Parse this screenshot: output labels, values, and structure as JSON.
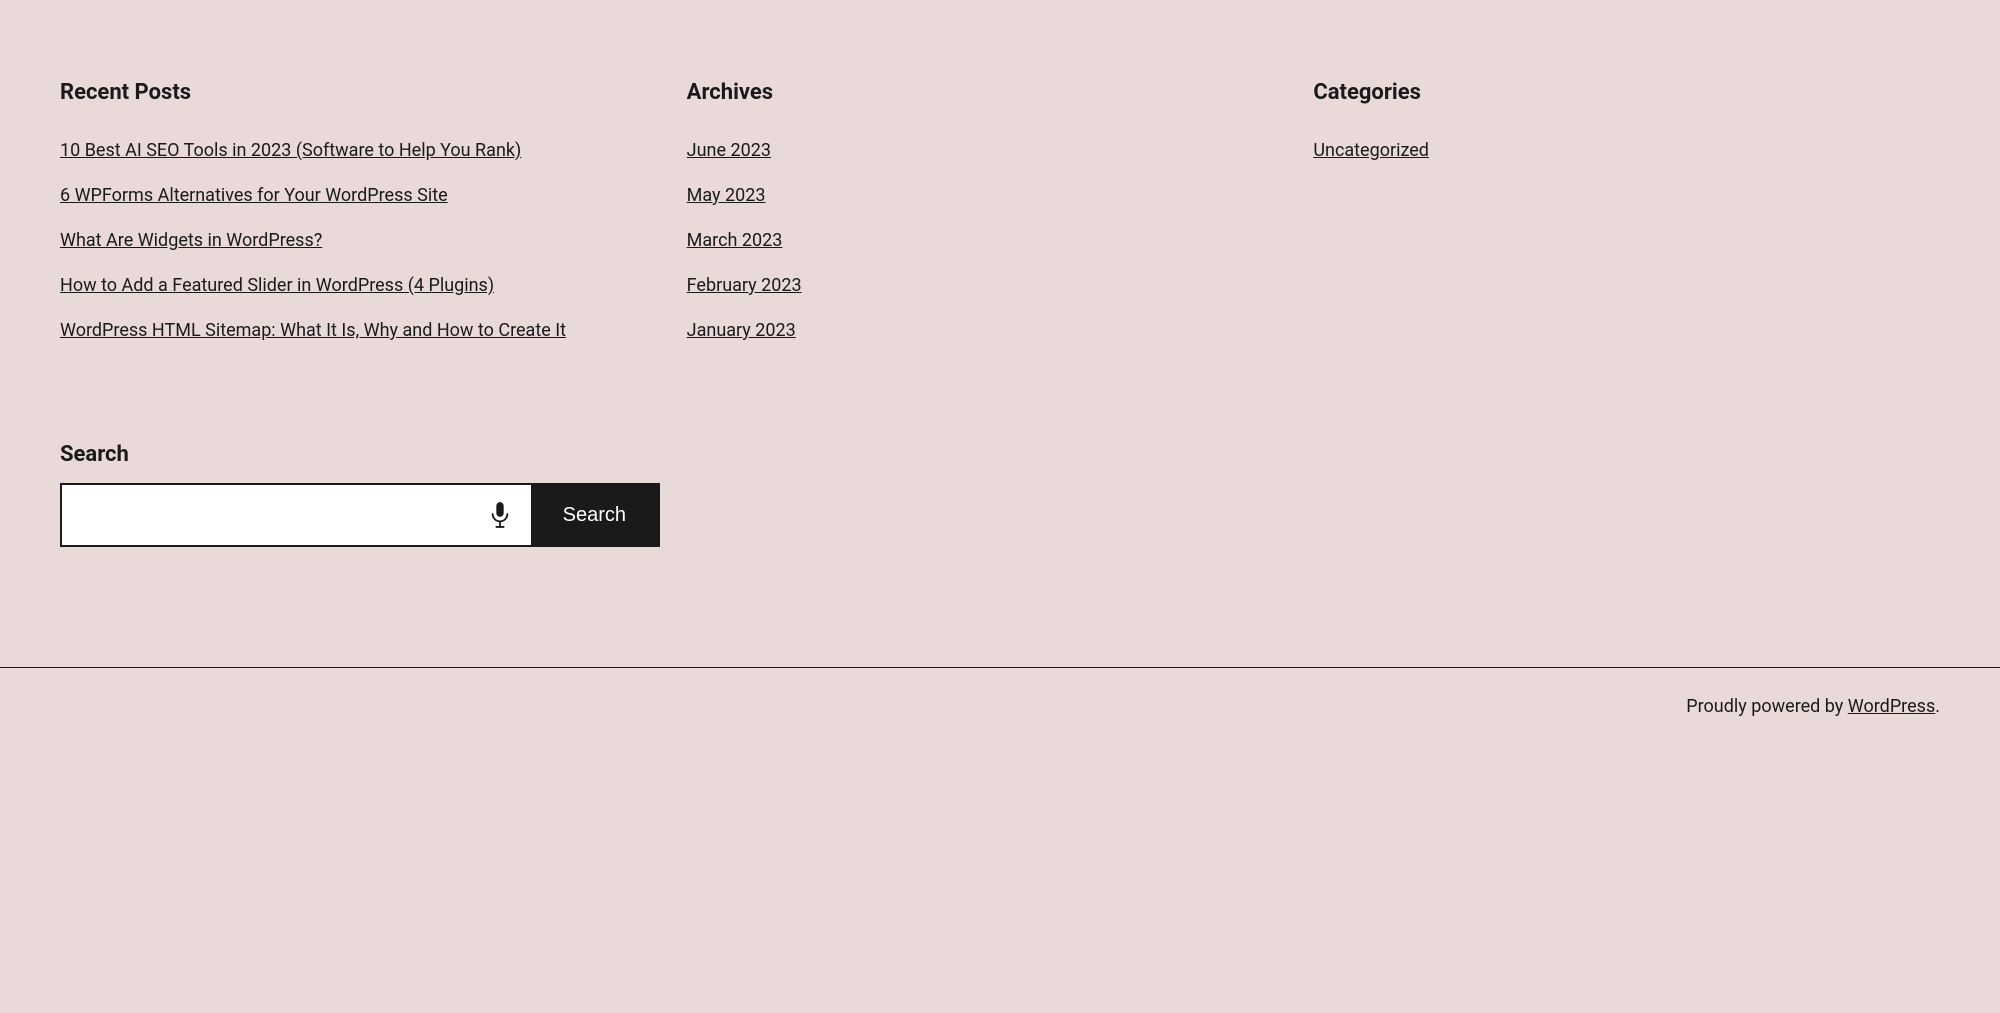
{
  "recentPosts": {
    "title": "Recent Posts",
    "items": [
      {
        "label": "10 Best AI SEO Tools in 2023 (Software to Help You Rank)",
        "href": "#"
      },
      {
        "label": "6 WPForms Alternatives for Your WordPress Site",
        "href": "#"
      },
      {
        "label": "What Are Widgets in WordPress?",
        "href": "#"
      },
      {
        "label": "How to Add a Featured Slider in WordPress (4 Plugins)",
        "href": "#"
      },
      {
        "label": "WordPress HTML Sitemap: What It Is, Why and How to Create It",
        "href": "#"
      }
    ]
  },
  "archives": {
    "title": "Archives",
    "items": [
      {
        "label": "June 2023",
        "href": "#"
      },
      {
        "label": "May 2023",
        "href": "#"
      },
      {
        "label": "March 2023",
        "href": "#"
      },
      {
        "label": "February 2023",
        "href": "#"
      },
      {
        "label": "January 2023",
        "href": "#"
      }
    ]
  },
  "categories": {
    "title": "Categories",
    "items": [
      {
        "label": "Uncategorized",
        "href": "#"
      }
    ]
  },
  "search": {
    "label": "Search",
    "placeholder": "",
    "button_label": "Search"
  },
  "footer": {
    "text": "Proudly powered by ",
    "link_label": "WordPress",
    "period": "."
  }
}
